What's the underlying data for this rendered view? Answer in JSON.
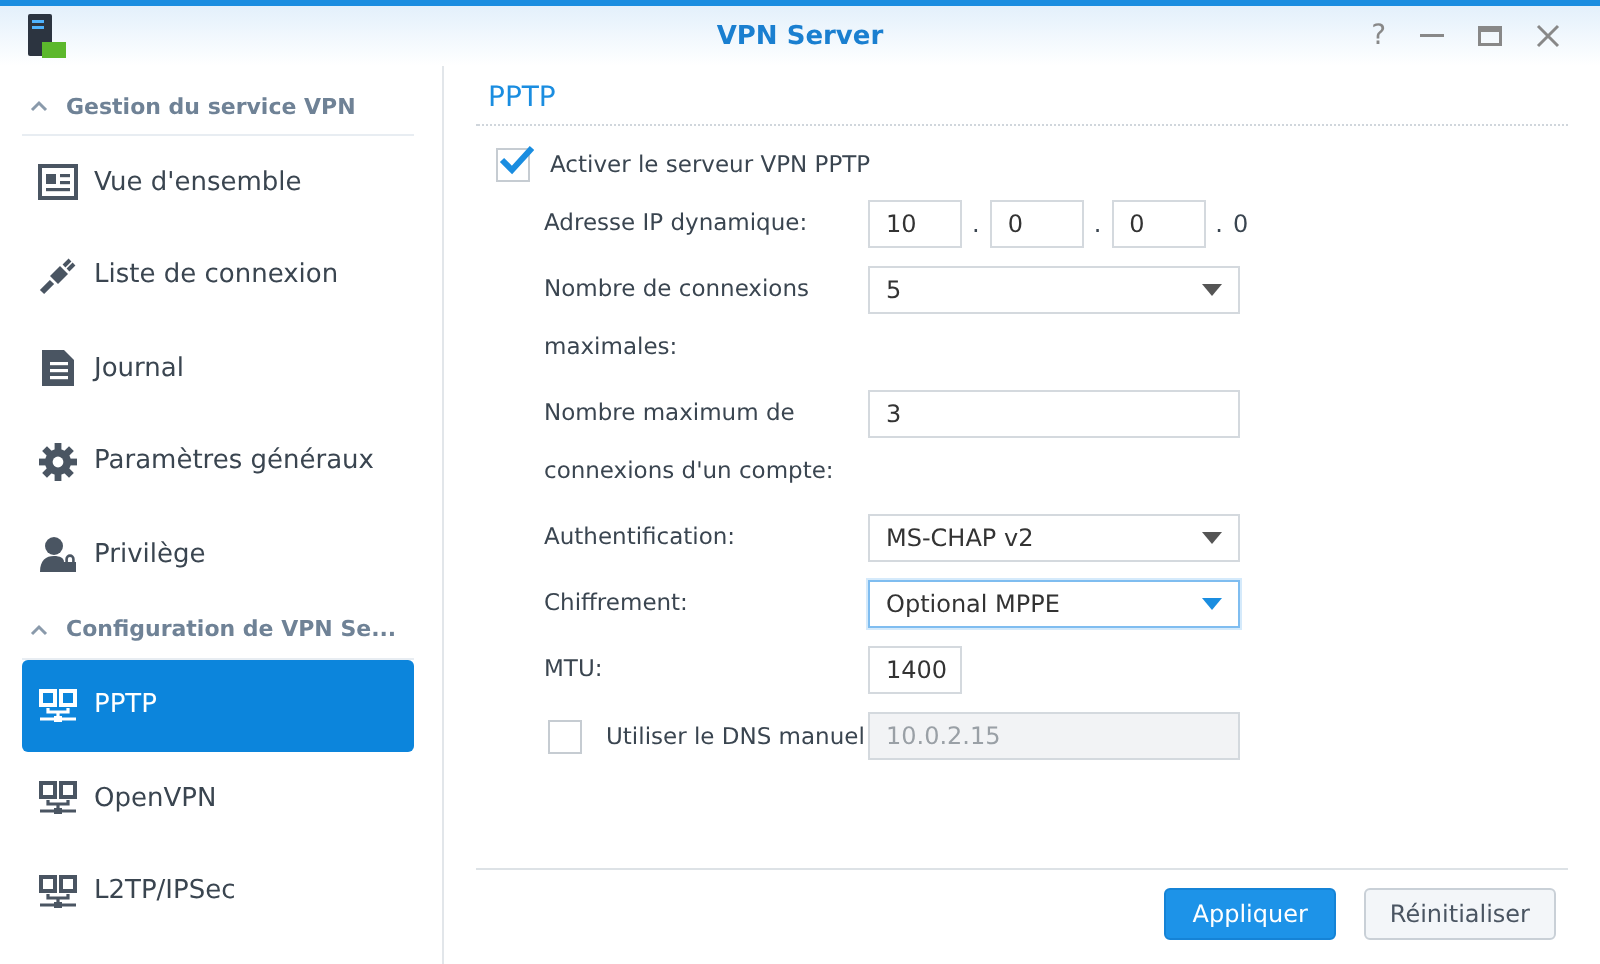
{
  "window": {
    "title": "VPN Server",
    "controls": [
      {
        "kind": "help",
        "label": "?"
      },
      {
        "kind": "minimize"
      },
      {
        "kind": "maximize"
      },
      {
        "kind": "close"
      }
    ]
  },
  "sidebar": {
    "sections": [
      {
        "title": "Gestion du service VPN",
        "expanded": true,
        "items": [
          {
            "kind": "overview",
            "label": "Vue d'ensemble",
            "selected": false
          },
          {
            "kind": "connections",
            "label": "Liste de connexion",
            "selected": false
          },
          {
            "kind": "log",
            "label": "Journal",
            "selected": false
          },
          {
            "kind": "settings",
            "label": "Paramètres généraux",
            "selected": false
          },
          {
            "kind": "privilege",
            "label": "Privilège",
            "selected": false
          }
        ]
      },
      {
        "title": "Configuration de VPN Se...",
        "expanded": true,
        "items": [
          {
            "kind": "network",
            "label": "PPTP",
            "selected": true
          },
          {
            "kind": "network",
            "label": "OpenVPN",
            "selected": false
          },
          {
            "kind": "network",
            "label": "L2TP/IPSec",
            "selected": false
          }
        ]
      }
    ]
  },
  "panel": {
    "title": "PPTP",
    "enable": {
      "label": "Activer le serveur VPN PPTP",
      "checked": true
    },
    "rows": [
      {
        "kind": "ip",
        "label": "Adresse IP dynamique:",
        "parts": [
          {
            "kind": "input",
            "text": "10"
          },
          {
            "kind": "text",
            "text": "."
          },
          {
            "kind": "input",
            "text": "0"
          },
          {
            "kind": "text",
            "text": "."
          },
          {
            "kind": "input",
            "text": "0"
          },
          {
            "kind": "text",
            "text": "."
          },
          {
            "kind": "text",
            "text": "0"
          }
        ]
      },
      {
        "kind": "select",
        "label": "Nombre de connexions maximales:",
        "value": "5",
        "focused": false
      },
      {
        "kind": "text",
        "label": "Nombre maximum de connexions d'un compte:",
        "value": "3"
      },
      {
        "kind": "select",
        "label": "Authentification:",
        "value": "MS-CHAP v2",
        "focused": false
      },
      {
        "kind": "select",
        "label": "Chiffrement:",
        "value": "Optional MPPE",
        "focused": true
      },
      {
        "kind": "short",
        "label": "MTU:",
        "value": "1400"
      },
      {
        "kind": "check",
        "label": "Utiliser le DNS manuel",
        "checked": false,
        "value": "10.0.2.15",
        "disabled": true
      }
    ]
  },
  "buttons": [
    {
      "kind": "primary",
      "label": "Appliquer"
    },
    {
      "kind": "secondary",
      "label": "Réinitialiser"
    }
  ]
}
